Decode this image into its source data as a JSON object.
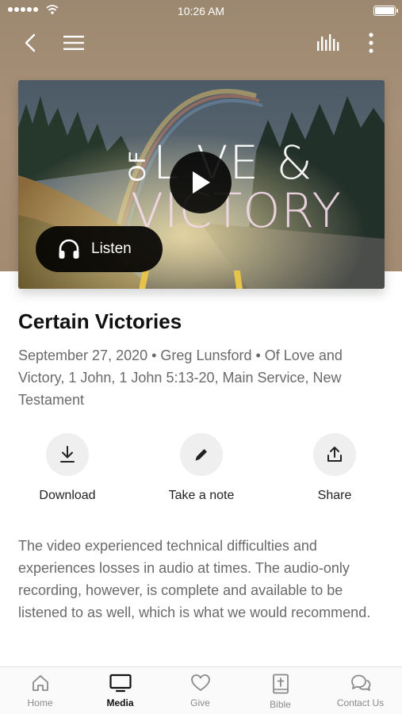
{
  "status_bar": {
    "time": "10:26 AM"
  },
  "nav": {
    "back_icon": "chevron-left-icon",
    "menu_icon": "hamburger-menu-icon",
    "audio_icon": "audio-bars-icon",
    "more_icon": "more-vertical-icon"
  },
  "media": {
    "artwork_text": {
      "of": "OF",
      "love": "L  VE &",
      "victory": "VICTORY"
    },
    "listen_label": "Listen"
  },
  "sermon": {
    "title": "Certain Victories",
    "meta": "September 27, 2020 • Greg Lunsford • Of Love and Victory, 1 John, 1 John 5:13-20, Main Service, New Testament"
  },
  "actions": [
    {
      "label": "Download",
      "icon": "download-icon"
    },
    {
      "label": "Take a note",
      "icon": "pencil-icon"
    },
    {
      "label": "Share",
      "icon": "share-icon"
    }
  ],
  "description": "The video experienced technical difficulties and experiences losses in audio at times. The audio-only recording, however, is complete and available to be listened to as well, which is what we would recommend.",
  "tabs": [
    {
      "label": "Home",
      "icon": "home-icon",
      "active": false
    },
    {
      "label": "Media",
      "icon": "tv-icon",
      "active": true
    },
    {
      "label": "Give",
      "icon": "heart-icon",
      "active": false
    },
    {
      "label": "Bible",
      "icon": "bible-icon",
      "active": false
    },
    {
      "label": "Contact Us",
      "icon": "chat-bubbles-icon",
      "active": false
    }
  ],
  "colors": {
    "hero_background": "#a38b72",
    "accent": "#111111",
    "muted_text": "#6a6a6a"
  }
}
